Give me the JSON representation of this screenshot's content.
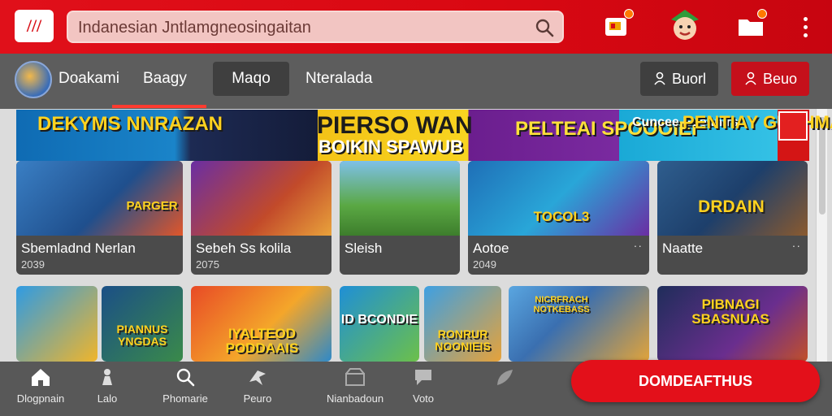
{
  "app": {
    "logo_text": "///"
  },
  "search": {
    "value": "Indanesian Jntlamgneosingaitan"
  },
  "subnav": {
    "user_label": "Doakami",
    "tabs": [
      {
        "label": "Baagy"
      },
      {
        "label": "Maqo"
      },
      {
        "label": "Nteralada"
      }
    ],
    "login_label": "Buorl",
    "signup_label": "Beuo"
  },
  "banner": {
    "left_title": "DEKYMS NNRAZAN",
    "center_title": "PIERSO WAN",
    "center_sub": "BOIKIN SPAWUB",
    "mid_title": "PELTEAI SPOOOIEI",
    "right_small": "Cuncee Eueunirs",
    "right_title": "PENTIAY GUSHMAS"
  },
  "cards": [
    {
      "title": "Sbemladnd Nerlan",
      "year": "2039",
      "art_text": "PARGER"
    },
    {
      "title": "Sebeh Ss kolila",
      "year": "2075",
      "art_text": ""
    },
    {
      "title": "Sleish",
      "year": "",
      "art_text": ""
    },
    {
      "title": "Aotoe",
      "year": "2049",
      "art_text": "TOCOL3"
    },
    {
      "title": "Naatte",
      "year": "",
      "art_text": "DRDAIN"
    }
  ],
  "tiles": [
    {
      "text": ""
    },
    {
      "text": "PIANNUS YNGDAS"
    },
    {
      "text": "IYALTEOD PODDAAIS"
    },
    {
      "text": "ID BCONDIE"
    },
    {
      "text": "RONRUR NOONIEIS"
    },
    {
      "text": "NICRFRACH NOTKEBASS"
    },
    {
      "text": "PIBNAGI SBASNUAS"
    }
  ],
  "bottomnav": {
    "items": [
      {
        "label": "Dlogpnain",
        "icon": "home-icon"
      },
      {
        "label": "Lalo",
        "icon": "person-icon"
      },
      {
        "label": "Phomarie",
        "icon": "search-icon"
      },
      {
        "label": "Peuro",
        "icon": "bird-icon"
      },
      {
        "label": "Nianbadoun",
        "icon": "store-icon"
      },
      {
        "label": "Voto",
        "icon": "chat-icon"
      },
      {
        "label": "",
        "icon": "leaf-icon"
      }
    ],
    "cta_label": "DOMDEAFTHUS"
  },
  "colors": {
    "brand_red": "#e0101a",
    "dark_gray": "#4b4b4b",
    "accent_yellow": "#ffd21f"
  }
}
